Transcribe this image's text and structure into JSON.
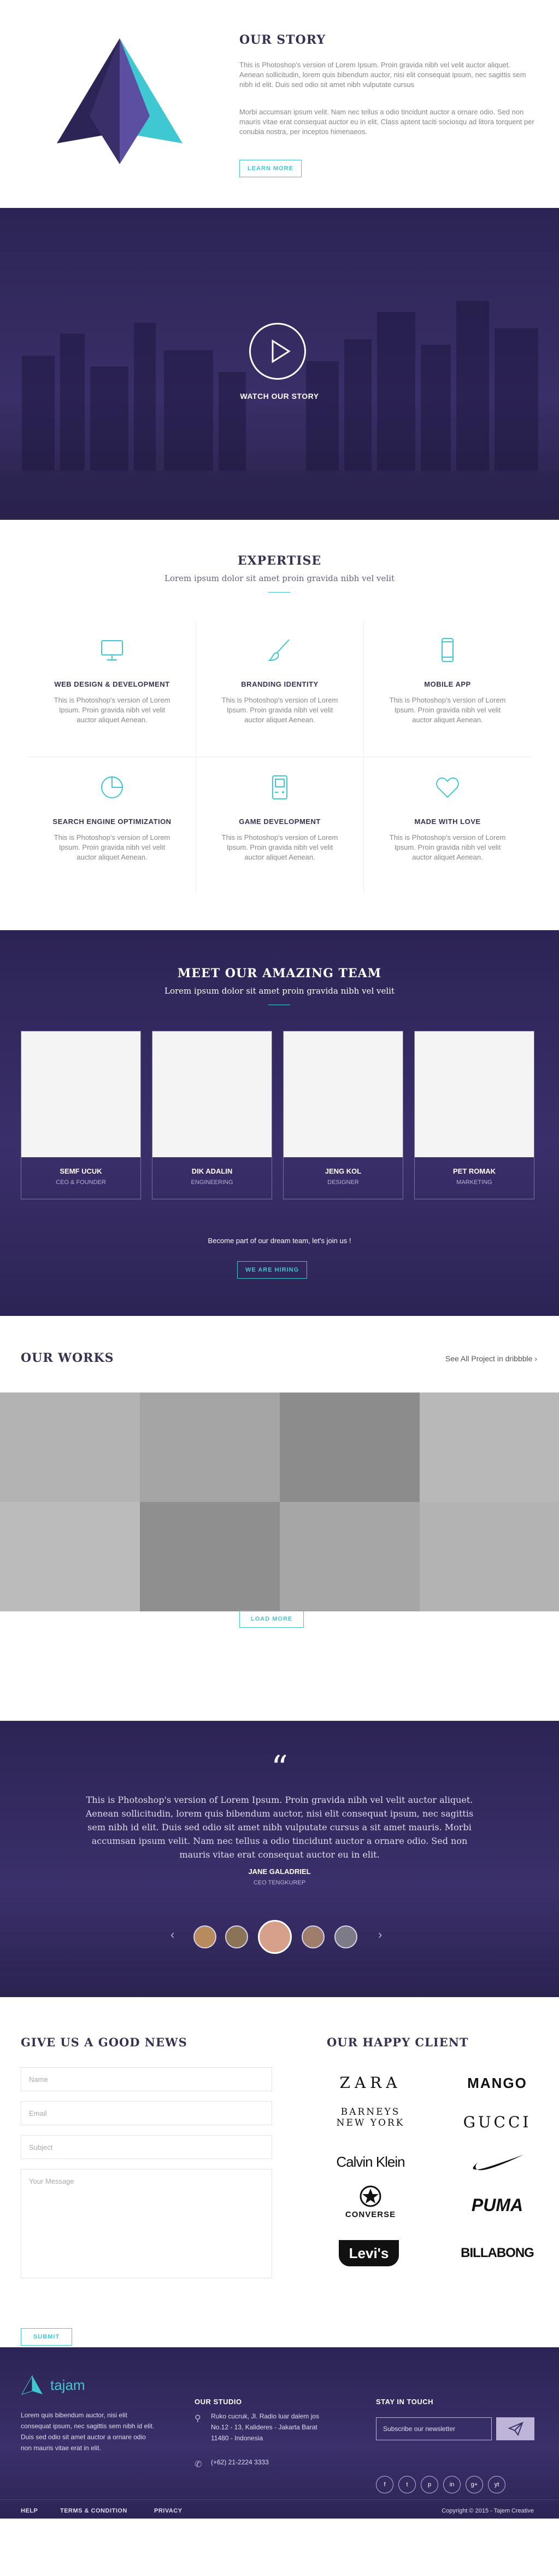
{
  "story": {
    "title": "OUR STORY",
    "p1": "This is Photoshop's version  of Lorem Ipsum. Proin gravida nibh vel velit auctor aliquet. Aenean sollicitudin, lorem quis bibendum auctor, nisi elit consequat ipsum, nec sagittis sem nibh id elit. Duis sed odio sit amet nibh vulputate cursus",
    "p2": "Morbi accumsan ipsum velit. Nam nec tellus a odio tincidunt auctor a ornare odio. Sed non  mauris vitae erat consequat auctor eu in elit. Class aptent taciti sociosqu ad litora torquent per conubia nostra, per inceptos himenaeos.",
    "button": "LEARN MORE"
  },
  "video": {
    "label": "WATCH OUR STORY"
  },
  "expertise": {
    "title": "EXPERTISE",
    "subtitle": "Lorem ipsum dolor sit amet proin gravida nibh vel velit",
    "items": [
      {
        "icon": "monitor-icon",
        "title": "WEB DESIGN & DEVELOPMENT",
        "text": "This is Photoshop's version  of Lorem Ipsum. Proin gravida nibh vel velit auctor aliquet Aenean."
      },
      {
        "icon": "brush-icon",
        "title": "BRANDING IDENTITY",
        "text": "This is Photoshop's version  of Lorem Ipsum. Proin gravida nibh vel velit auctor aliquet Aenean."
      },
      {
        "icon": "mobile-icon",
        "title": "MOBILE APP",
        "text": "This is Photoshop's version  of Lorem Ipsum. Proin gravida nibh vel velit auctor aliquet Aenean."
      },
      {
        "icon": "pie-chart-icon",
        "title": "SEARCH ENGINE OPTIMIZATION",
        "text": "This is Photoshop's version  of Lorem Ipsum. Proin gravida nibh vel velit auctor aliquet Aenean."
      },
      {
        "icon": "gameboy-icon",
        "title": "GAME DEVELOPMENT",
        "text": "This is Photoshop's version  of Lorem Ipsum. Proin gravida nibh vel velit auctor aliquet Aenean."
      },
      {
        "icon": "heart-icon",
        "title": "MADE WITH LOVE",
        "text": "This is Photoshop's version  of Lorem Ipsum. Proin gravida nibh vel velit auctor aliquet Aenean."
      }
    ]
  },
  "team": {
    "title": "MEET OUR AMAZING TEAM",
    "subtitle": "Lorem ipsum dolor sit amet proin gravida nibh vel velit",
    "members": [
      {
        "name": "SEMF UCUK",
        "role": "CEO & FOUNDER"
      },
      {
        "name": "DIK ADALIN",
        "role": "ENGINEERING"
      },
      {
        "name": "JENG KOL",
        "role": "DESIGNER"
      },
      {
        "name": "PET ROMAK",
        "role": "MARKETING"
      }
    ],
    "join_text": "Become part of our dream team, let's join us !",
    "button": "WE ARE HIRING"
  },
  "works": {
    "title": "OUR WORKS",
    "see_all": "See All Project in dribbble",
    "tiles": [
      "#b3b3b3",
      "#a5a5a5",
      "#8c8c8c",
      "#b8b8b8",
      "#bbbbbb",
      "#8f8f8f",
      "#a6a6a6",
      "#b3b3b3"
    ],
    "button": "LOAD MORE"
  },
  "testimonial": {
    "quote_mark": "“",
    "text": "This is Photoshop's version  of Lorem Ipsum. Proin gravida nibh vel velit auctor aliquet. Aenean sollicitudin, lorem quis bibendum auctor, nisi elit consequat ipsum, nec sagittis sem nibh id elit. Duis sed odio sit amet nibh vulputate cursus a sit amet mauris. Morbi accumsan ipsum velit. Nam nec tellus a odio tincidunt auctor a ornare odio. Sed non  mauris vitae erat consequat auctor eu in elit.",
    "name": "JANE GALADRIEL",
    "role": "CEO TENGKUREP"
  },
  "contact": {
    "title": "GIVE US A GOOD NEWS",
    "name_placeholder": "Name",
    "email_placeholder": "Email",
    "subject_placeholder": "Subject",
    "message_placeholder": "Your Message",
    "button": "SUBMIT"
  },
  "clients": {
    "title": "OUR HAPPY CLIENT",
    "brands": [
      "ZARA",
      "MANGO",
      "BARNEYS NEW YORK",
      "GUCCI",
      "Calvin Klein",
      "nike",
      "CONVERSE",
      "PUMA",
      "Levi's",
      "BILLABONG"
    ]
  },
  "footer": {
    "logo": "tajam",
    "about": "Lorem quis bibendum auctor, nisi elit consequat ipsum, nec sagittis sem nibh id elit. Duis sed odio sit amet auctor a ornare odio non mauris vitae erat in elit.",
    "studio_title": "OUR STUDIO",
    "address": "Ruko cucruk, Jl. Radio luar dalem jos No.12 - 13, Kalideres - Jakarta Barat 11480 - Indonesia",
    "phone": "(+62) 21-2224 3333",
    "touch_title": "STAY IN TOUCH",
    "newsletter_placeholder": "Subscribe our newsletter",
    "social": [
      "f",
      "t",
      "p",
      "in",
      "g+",
      "yt"
    ],
    "links": [
      "HELP",
      "TERMS & CONDITION",
      "PRIVACY"
    ],
    "copyright": "Copyright © 2015 - Tajem Creative"
  }
}
